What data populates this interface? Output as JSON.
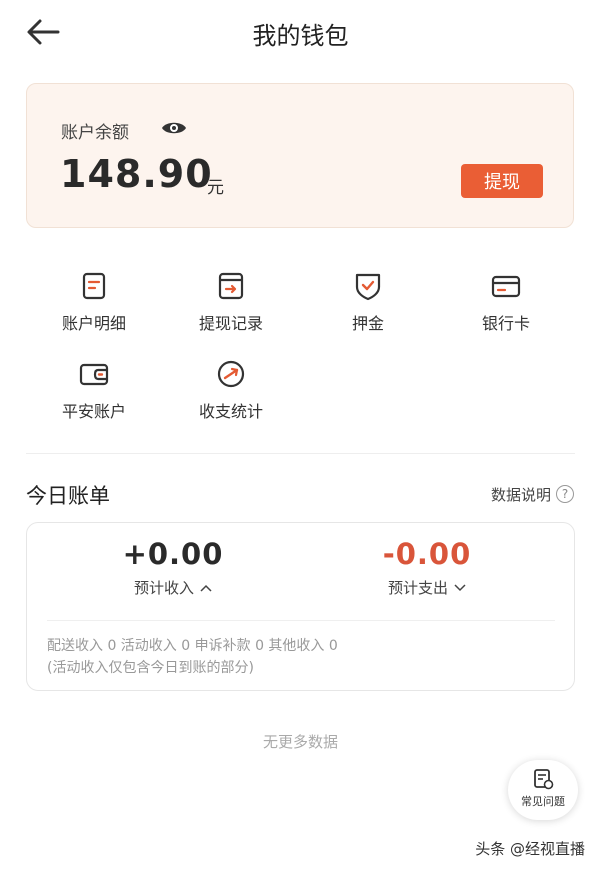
{
  "header": {
    "title": "我的钱包"
  },
  "balance": {
    "label": "账户余额",
    "amount": "148.90",
    "unit": "元",
    "withdraw_label": "提现"
  },
  "menu": [
    {
      "label": "账户明细",
      "icon": "document-icon"
    },
    {
      "label": "提现记录",
      "icon": "withdraw-record-icon"
    },
    {
      "label": "押金",
      "icon": "shield-check-icon"
    },
    {
      "label": "银行卡",
      "icon": "bank-card-icon"
    },
    {
      "label": "平安账户",
      "icon": "wallet-icon"
    },
    {
      "label": "收支统计",
      "icon": "statistics-icon"
    }
  ],
  "today": {
    "title": "今日账单",
    "data_note": "数据说明",
    "income_amount": "+0.00",
    "income_label": "预计收入",
    "expense_amount": "-0.00",
    "expense_label": "预计支出",
    "breakdown": "配送收入 0 活动收入 0 申诉补款 0 其他收入 0",
    "note": "(活动收入仅包含今日到账的部分)"
  },
  "footer": {
    "no_more": "无更多数据",
    "faq_label": "常见问题",
    "watermark": "头条 @经视直播"
  },
  "colors": {
    "accent": "#ea5e35",
    "card_bg": "#fdf4ee",
    "expense": "#d9553a"
  }
}
